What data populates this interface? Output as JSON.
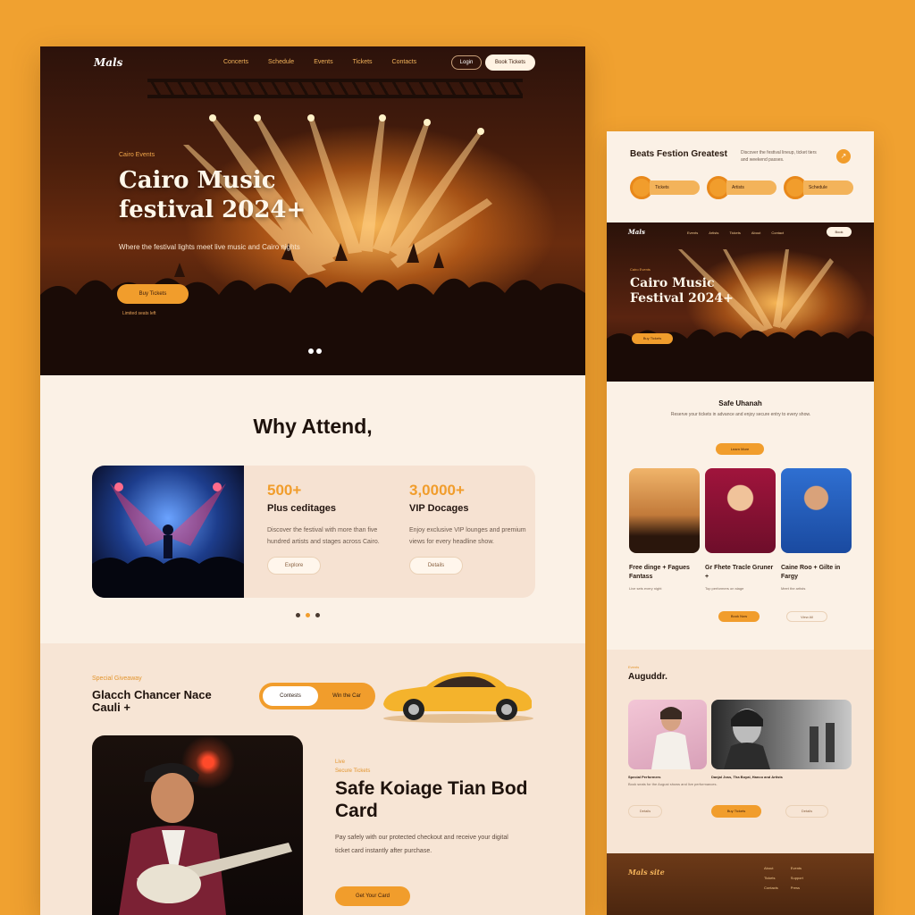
{
  "main": {
    "nav": {
      "logo": "Mals",
      "links": [
        "Concerts",
        "Schedule",
        "Events",
        "Tickets",
        "Contacts"
      ],
      "login": "Login",
      "cta": "Book Tickets"
    },
    "hero": {
      "eyebrow": "Cairo Events",
      "title": "Cairo Music festival 2024+",
      "subtitle": "Where the festival lights meet live music and Cairo nights",
      "cta": "Buy Tickets",
      "note": "Limited seats left"
    },
    "why": {
      "title": "Why Attend,",
      "stats": [
        {
          "number": "500+",
          "label": "Plus ceditages",
          "desc": "Discover the festival with more than five hundred artists and stages across Cairo.",
          "button": "Explore"
        },
        {
          "number": "3,0000+",
          "label": "VIP Docages",
          "desc": "Enjoy exclusive VIP lounges and premium views for every headline show.",
          "button": "Details"
        }
      ]
    },
    "chance": {
      "eyebrow": "Special Giveaway",
      "title": "Glacch Chancer Nace Cauli +",
      "toggle_a": "Contests",
      "toggle_b": "Win the Car"
    },
    "safe": {
      "eyebrow": "Live",
      "eyebrow2": "Secure Tickets",
      "title": "Safe Koiage Tian Bod Card",
      "desc": "Pay safely with our protected checkout and receive your digital ticket card instantly after purchase.",
      "cta": "Get Your Card"
    }
  },
  "side": {
    "header": {
      "title": "Beats Festion Greatest",
      "desc": "Discover the festival lineup, ticket tiers and weekend passes.",
      "pills": [
        "Tickets",
        "Artists",
        "Schedule"
      ]
    },
    "hero": {
      "logo": "Mals",
      "nav": [
        "Events",
        "Artists",
        "Tickets",
        "About",
        "Contact"
      ],
      "navbtn": "Book",
      "eyebrow": "Cairo Events",
      "title": "Cairo Music Festival 2024+",
      "cta": "Buy Tickets"
    },
    "why": {
      "title": "Safe Uhanah",
      "desc": "Reserve your tickets in advance and enjoy secure entry to every show.",
      "button": "Learn More"
    },
    "cards": [
      {
        "title": "Free dinge + Fagues Fantass",
        "desc": "Live sets every night"
      },
      {
        "title": "Gr Fhete Tracle Gruner +",
        "desc": "Top performers on stage"
      },
      {
        "title": "Caine Roo + Gilte in Fargy",
        "desc": "Meet the artists"
      }
    ],
    "row_buttons": [
      "Book Now",
      "View All"
    ],
    "august": {
      "eyebrow": "Events",
      "title": "Auguddr.",
      "caption1": "Special Performers",
      "caption2": "Danjal Joss, Tha Boyal, Hanco and Artists",
      "desc": "Book seats for the August shows and live performances.",
      "btn_a": "Buy Tickets",
      "btn_b": "Details"
    },
    "footer": {
      "brand": "Mals site",
      "links": [
        "About",
        "Events",
        "Tickets",
        "Support",
        "Contacts",
        "Press"
      ]
    }
  },
  "colors": {
    "accent": "#f19d2c",
    "background": "#f0a130",
    "page": "#fbf1e6",
    "dark": "#1e120c"
  }
}
